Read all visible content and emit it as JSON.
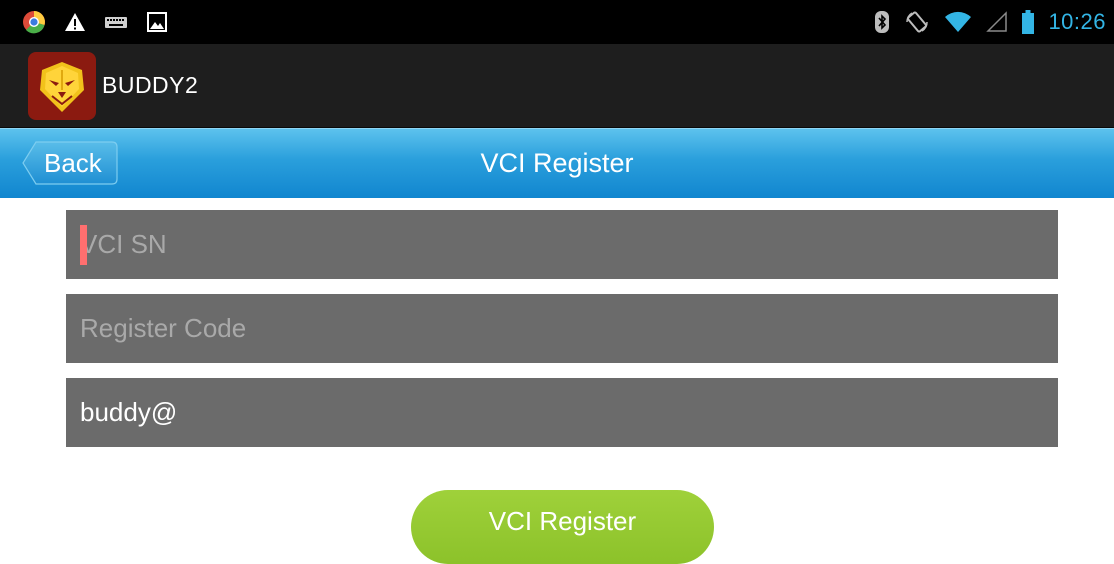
{
  "status_bar": {
    "time": "10:26",
    "time_color": "#33b5e5",
    "icons_left": [
      "chrome-icon",
      "warning-icon",
      "keyboard-icon",
      "image-icon"
    ],
    "icons_right": [
      "bluetooth-icon",
      "rotation-icon",
      "wifi-icon",
      "signal-icon",
      "battery-icon"
    ]
  },
  "app_bar": {
    "title": "BUDDY2",
    "logo": "lion-logo-icon"
  },
  "nav": {
    "back_label": "Back",
    "title": "VCI Register",
    "color": "#2a9fdc"
  },
  "form": {
    "vci_sn": {
      "value": "",
      "placeholder": "VCI SN"
    },
    "register_code": {
      "value": "",
      "placeholder": "Register Code"
    },
    "email": {
      "value": "buddy@",
      "placeholder": ""
    }
  },
  "register_button": {
    "label": "VCI Register",
    "color": "#8cc22a"
  }
}
